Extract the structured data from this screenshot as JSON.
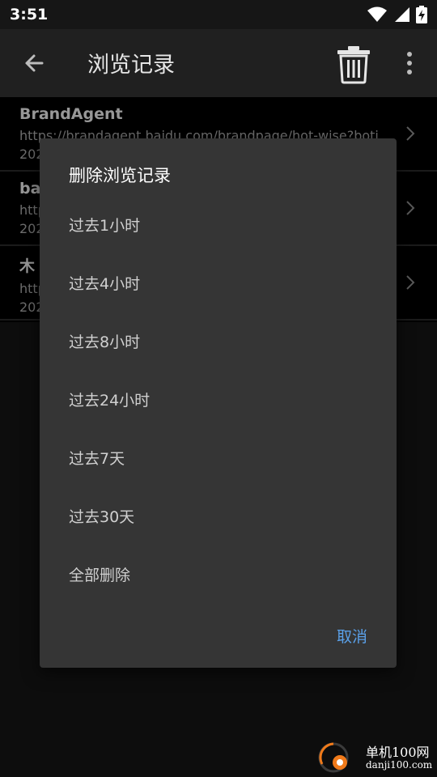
{
  "status_bar": {
    "time": "3:51",
    "icons": [
      "wifi-icon",
      "signal-icon",
      "battery-charging-icon"
    ]
  },
  "toolbar": {
    "title": "浏览记录",
    "back_icon": "arrow-left-icon",
    "delete_icon": "trash-icon",
    "more_icon": "more-vert-icon"
  },
  "history": [
    {
      "title": "BrandAgent",
      "url": "https://brandagent.baidu.com/brandpage/hot-wise?boti",
      "date": "202"
    },
    {
      "title": "bai",
      "url": "http",
      "date": "202"
    },
    {
      "title": "木",
      "url": "http",
      "date": "202"
    }
  ],
  "dialog": {
    "title": "删除浏览记录",
    "options": [
      "过去1小时",
      "过去4小时",
      "过去8小时",
      "过去24小时",
      "过去7天",
      "过去30天",
      "全部删除"
    ],
    "cancel": "取消"
  },
  "watermark": {
    "name": "单机100网",
    "domain": "danji100.com"
  },
  "colors": {
    "accent": "#5aa0e8",
    "dialog_bg": "#353535",
    "toolbar_bg": "#202020",
    "watermark_orange": "#f07a1a"
  }
}
